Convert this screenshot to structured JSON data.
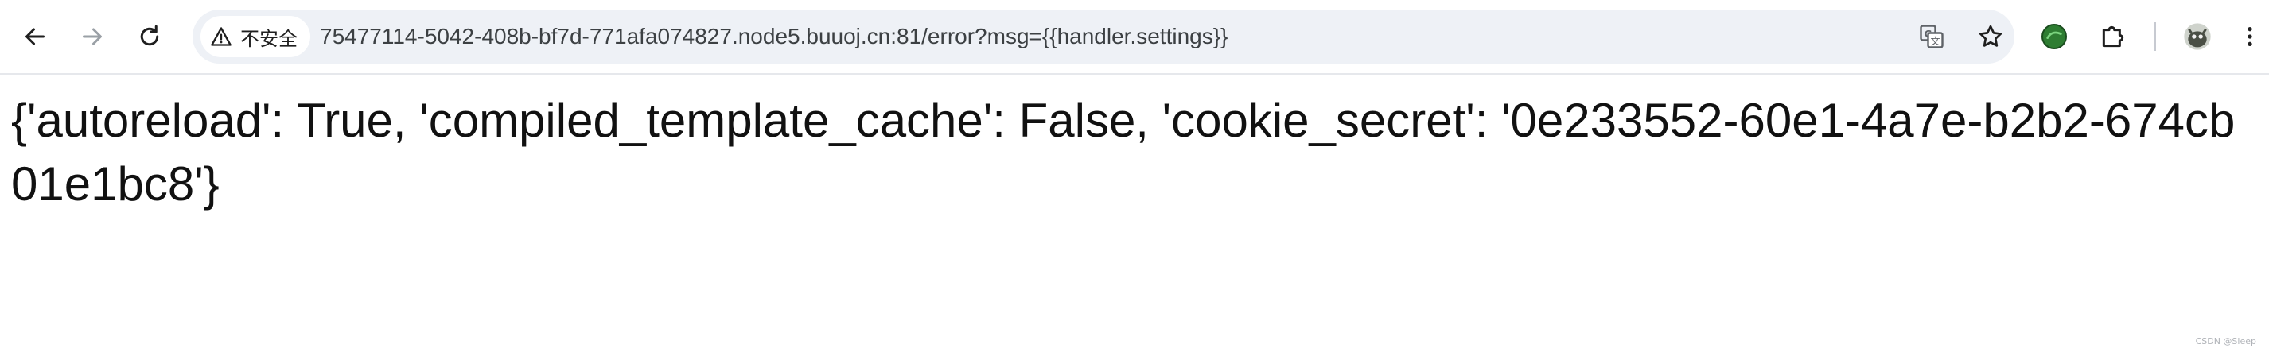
{
  "browser": {
    "security_label": "不安全",
    "url": "75477114-5042-408b-bf7d-771afa074827.node5.buuoj.cn:81/error?msg={{handler.settings}}",
    "icons": {
      "back": "arrow-left",
      "forward": "arrow-right",
      "reload": "circular-arrow",
      "security": "warning-triangle",
      "translate": "translate",
      "bookmark": "star",
      "extension_ball": "green-ball",
      "extensions": "puzzle-piece",
      "profile": "avatar",
      "menu": "vertical-dots"
    }
  },
  "page": {
    "text": "{'autoreload': True, 'compiled_template_cache': False, 'cookie_secret': '0e233552-60e1-4a7e-b2b2-674cb01e1bc8'}"
  },
  "watermark": "CSDN @Sleep"
}
